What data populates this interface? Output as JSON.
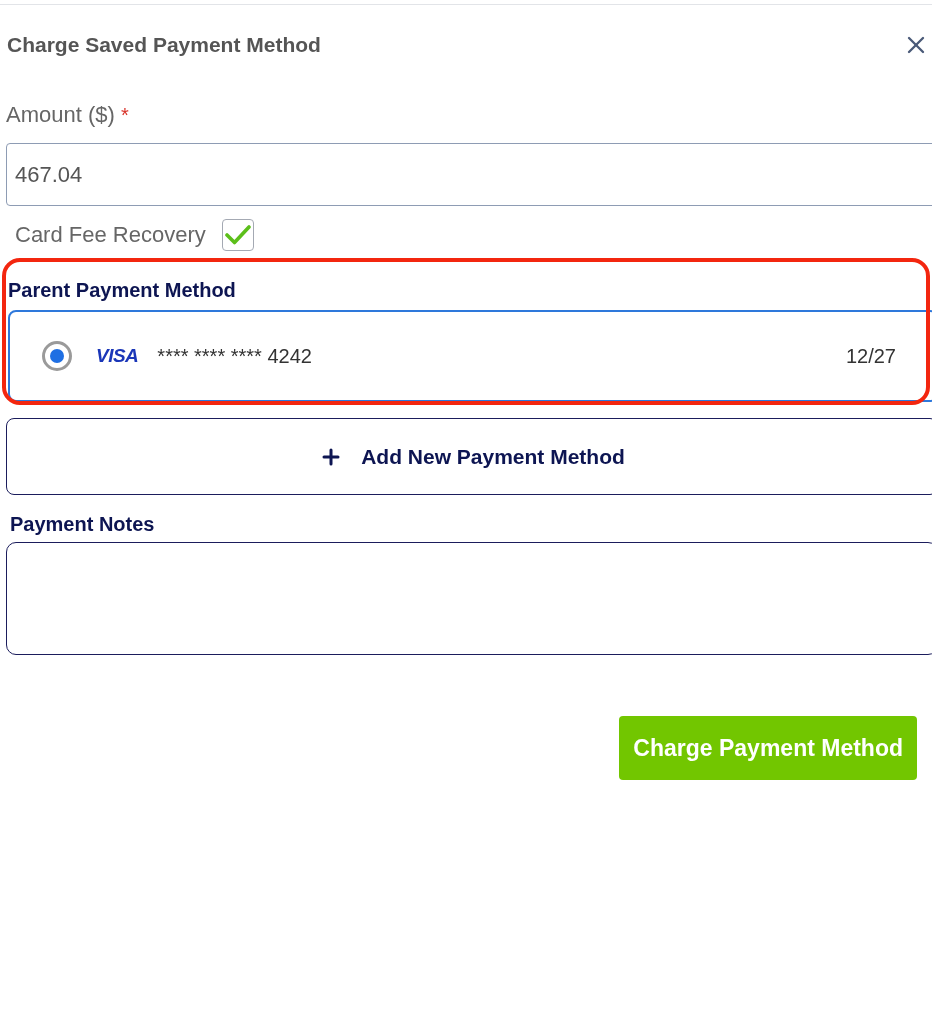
{
  "dialog": {
    "title": "Charge Saved Payment Method"
  },
  "amount": {
    "label": "Amount ($)",
    "required_mark": "*",
    "value": "467.04"
  },
  "card_fee_recovery": {
    "label": "Card Fee Recovery",
    "checked": true
  },
  "parent_payment_method": {
    "label": "Parent Payment Method",
    "highlighted": true,
    "cards": [
      {
        "brand": "VISA",
        "number": "**** **** **** 4242",
        "expiry": "12/27",
        "selected": true
      }
    ]
  },
  "add_payment_method": {
    "label": "Add New Payment Method"
  },
  "payment_notes": {
    "label": "Payment Notes"
  },
  "submit": {
    "label": "Charge Payment Method"
  }
}
